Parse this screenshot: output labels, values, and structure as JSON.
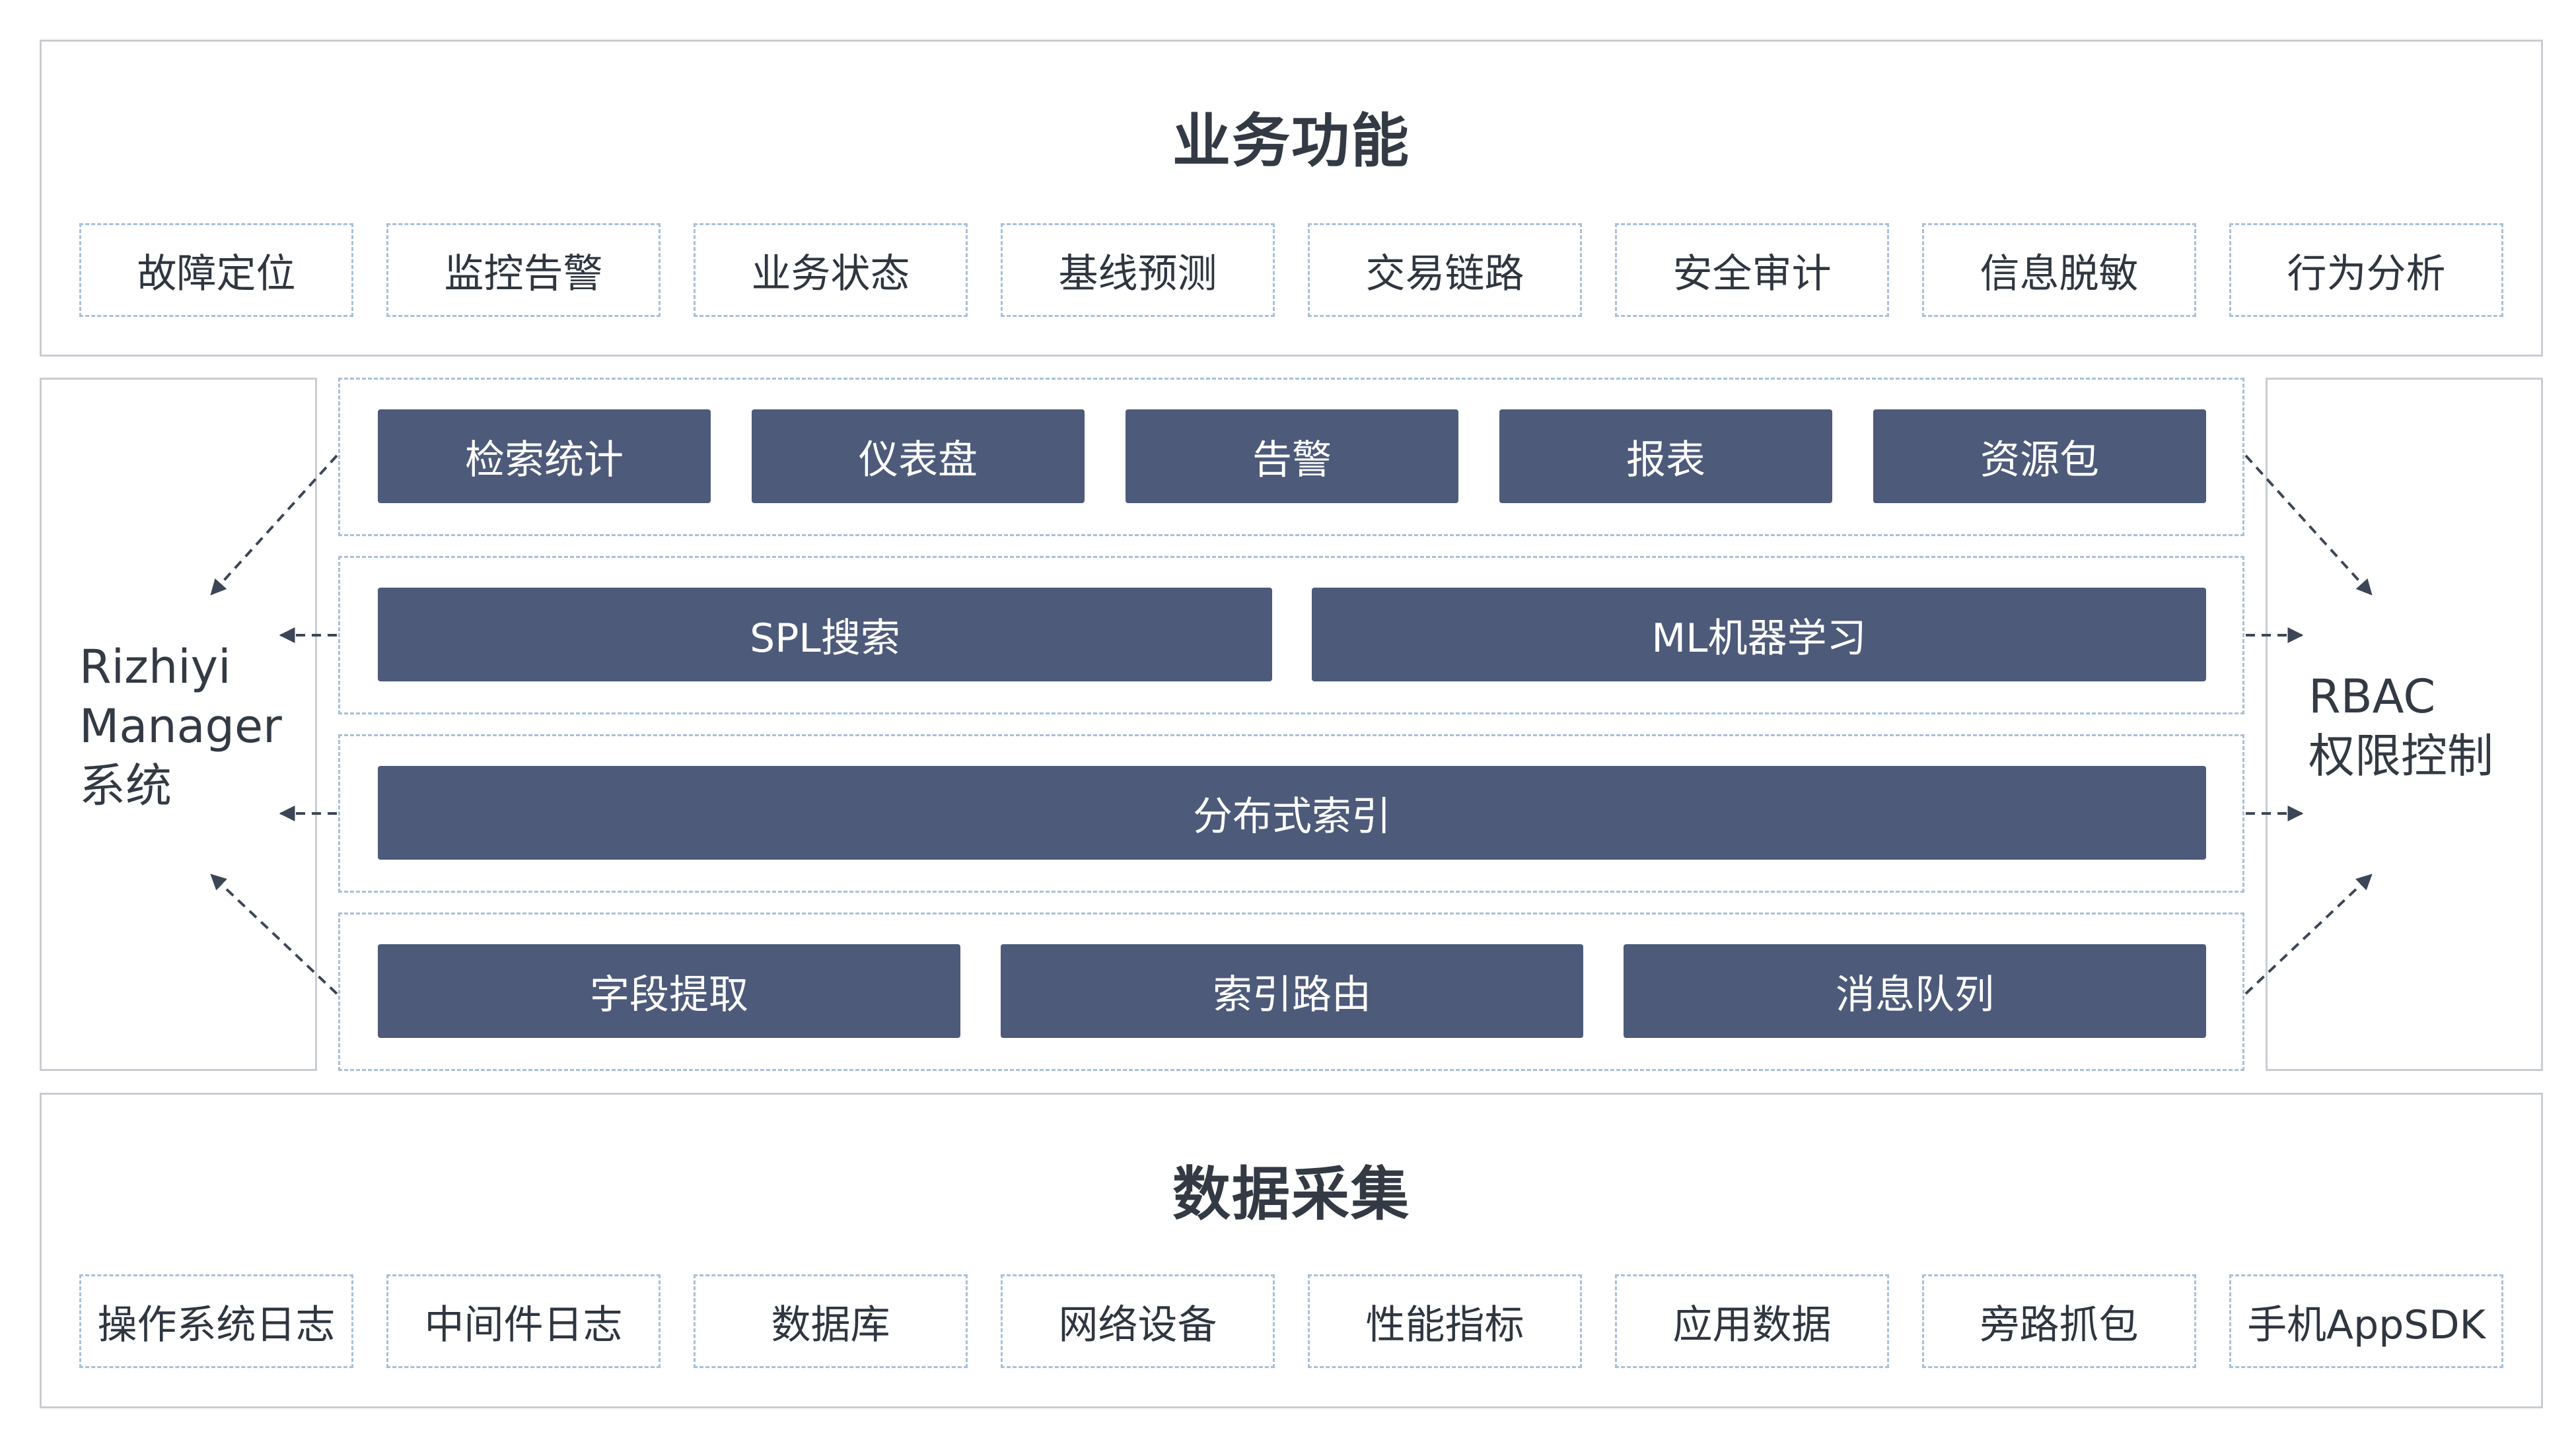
{
  "business": {
    "title": "业务功能",
    "items": [
      "故障定位",
      "监控告警",
      "业务状态",
      "基线预测",
      "交易链路",
      "安全审计",
      "信息脱敏",
      "行为分析"
    ]
  },
  "core": {
    "row1": [
      "检索统计",
      "仪表盘",
      "告警",
      "报表",
      "资源包"
    ],
    "row2": [
      "SPL搜索",
      "ML机器学习"
    ],
    "row3": [
      "分布式索引"
    ],
    "row4": [
      "字段提取",
      "索引路由",
      "消息队列"
    ]
  },
  "left_panel": {
    "line1": "Rizhiyi",
    "line2": "Manager",
    "line3": "系统"
  },
  "right_panel": {
    "line1": "RBAC",
    "line2": "权限控制"
  },
  "collection": {
    "title": "数据采集",
    "items": [
      "操作系统日志",
      "中间件日志",
      "数据库",
      "网络设备",
      "性能指标",
      "应用数据",
      "旁路抓包",
      "手机AppSDK"
    ]
  },
  "colors": {
    "module_fill": "#4d5a7a",
    "dashed_border": "#a9c0d8",
    "panel_border": "#c9cdd2",
    "arrow": "#3d4656"
  }
}
